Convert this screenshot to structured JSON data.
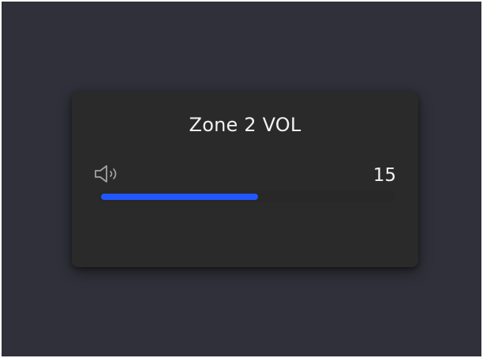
{
  "volume_card": {
    "title": "Zone 2 VOL",
    "icon": "speaker-icon",
    "value": "15",
    "level_fraction": 0.54,
    "accent_color": "#2257ff"
  }
}
